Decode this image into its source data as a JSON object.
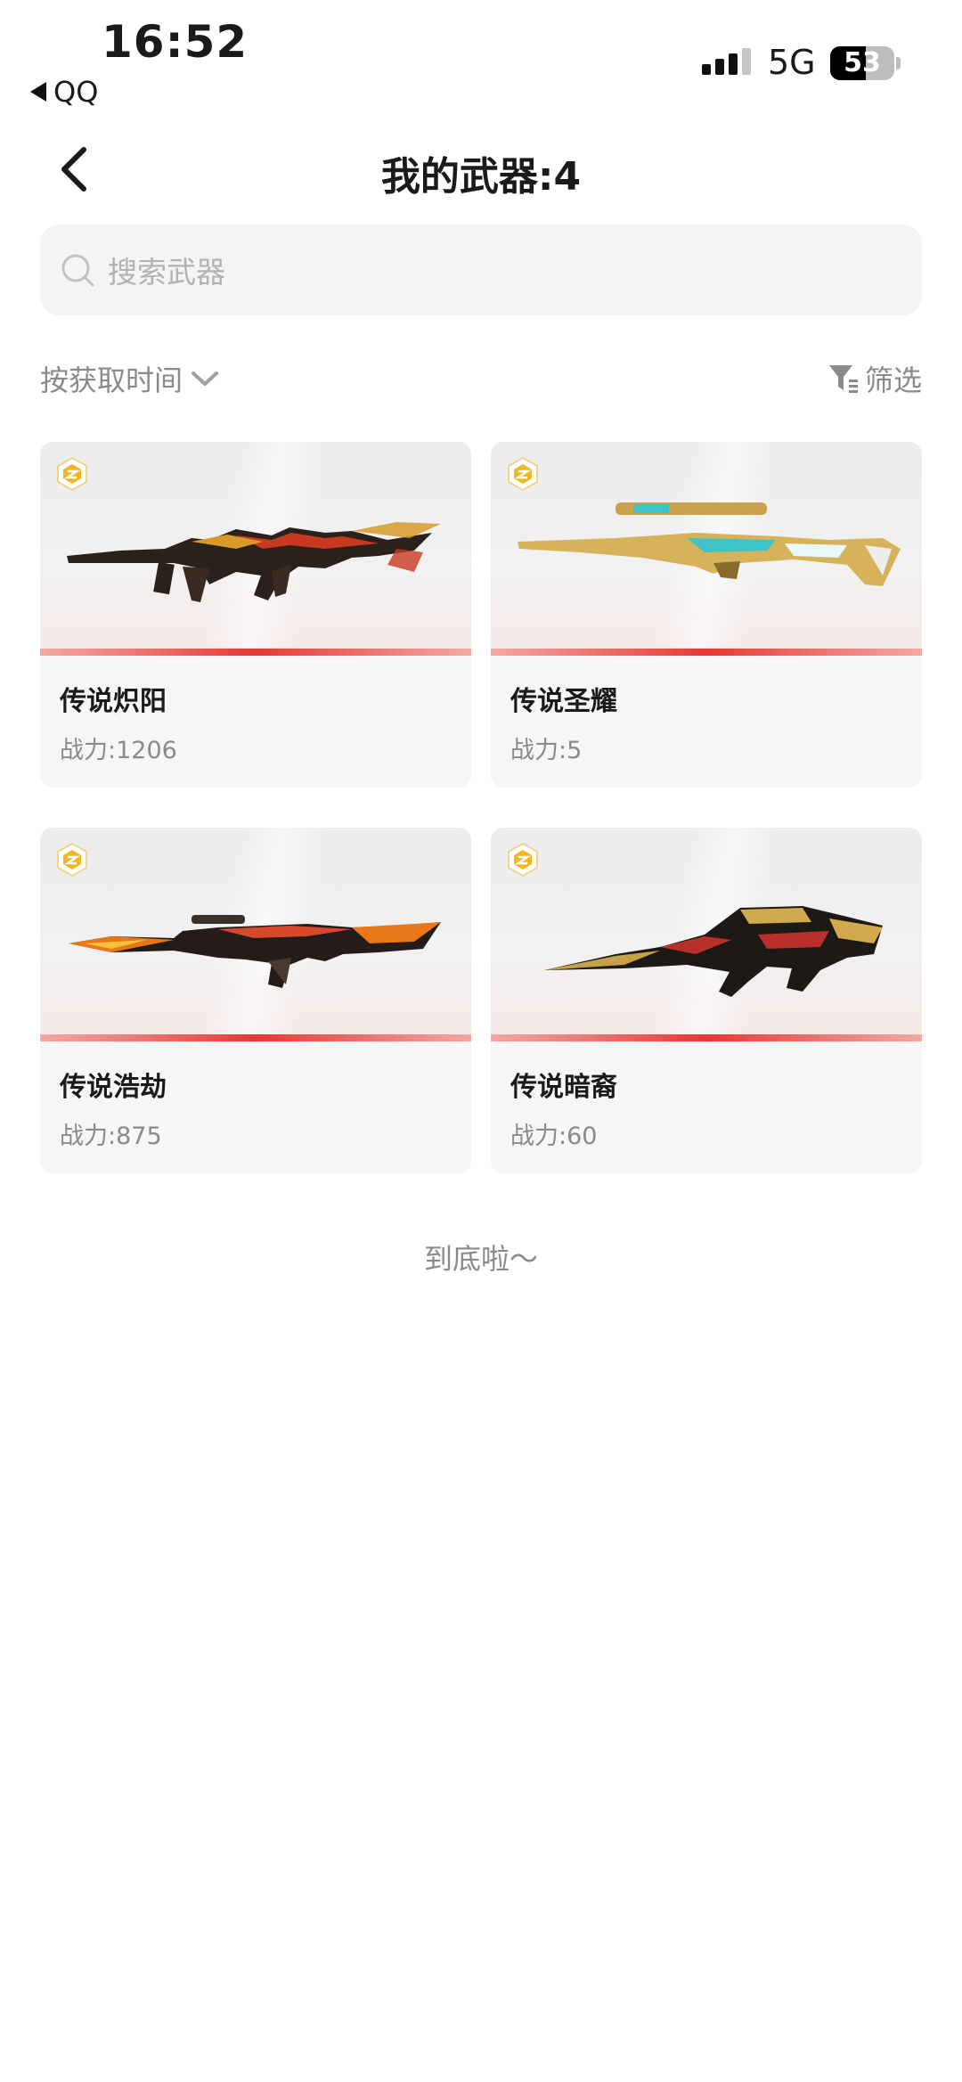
{
  "status_bar": {
    "time": "16:52",
    "back_app": "QQ",
    "network": "5G",
    "battery": "53"
  },
  "header": {
    "title": "我的武器:4"
  },
  "search": {
    "placeholder": "搜索武器"
  },
  "sort": {
    "label": "按获取时间"
  },
  "filter": {
    "label": "筛选"
  },
  "weapons": [
    {
      "name": "传说炽阳",
      "power": "战力:1206"
    },
    {
      "name": "传说圣耀",
      "power": "战力:5"
    },
    {
      "name": "传说浩劫",
      "power": "战力:875"
    },
    {
      "name": "传说暗裔",
      "power": "战力:60"
    }
  ],
  "footer": {
    "end_text": "到底啦～"
  },
  "colors": {
    "accent_red": "#e53935",
    "badge_gold": "#f2b61f",
    "text_secondary": "#8a8a8a"
  }
}
